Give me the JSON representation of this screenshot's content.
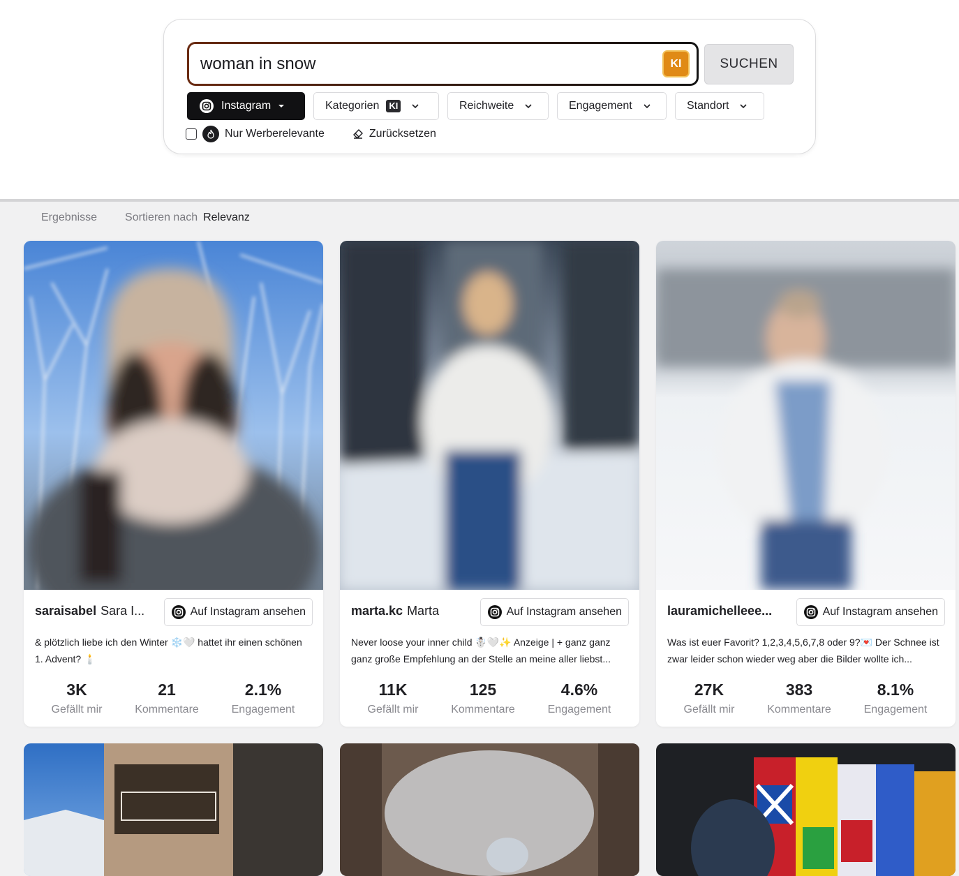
{
  "search": {
    "query": "woman in snow",
    "ki_label": "KI",
    "submit_label": "SUCHEN"
  },
  "filters": [
    {
      "label": "Instagram",
      "active": true
    },
    {
      "label": "Kategorien",
      "badge": "KI"
    },
    {
      "label": "Reichweite"
    },
    {
      "label": "Engagement"
    },
    {
      "label": "Standort"
    }
  ],
  "options": {
    "only_relevant": "Nur Werberelevante",
    "reset": "Zurücksetzen"
  },
  "results": {
    "label": "Ergebnisse",
    "sort_label": "Sortieren nach",
    "sort_value": "Relevanz"
  },
  "view_on_instagram": "Auf Instagram ansehen",
  "cards": [
    {
      "username": "saraisabel",
      "realname": "Sara I...",
      "caption": "& plötzlich liebe ich den Winter ❄️🤍 hattet ihr einen schönen 1. Advent? 🕯️",
      "likes": "3K",
      "comments": "21",
      "engagement": "2.1%"
    },
    {
      "username": "marta.kc",
      "realname": "Marta",
      "caption": "Never loose your inner child ☃️🤍✨ Anzeige | + ganz ganz ganz große Empfehlung an der Stelle an meine aller liebst...",
      "likes": "11K",
      "comments": "125",
      "engagement": "4.6%"
    },
    {
      "username": "lauramichelleee...",
      "realname": "",
      "caption": "Was ist euer Favorit? 1,2,3,4,5,6,7,8 oder 9?💌 Der Schnee ist zwar leider schon wieder weg aber die Bilder wollte ich...",
      "likes": "27K",
      "comments": "383",
      "engagement": "8.1%"
    }
  ],
  "stat_labels": {
    "likes": "Gefällt mir",
    "comments": "Kommentare",
    "engagement": "Engagement"
  },
  "colors": {
    "accent_orange": "#e08a16",
    "dark": "#111113",
    "page_bg": "#f1f1f2"
  },
  "icons": [
    "instagram-icon",
    "chevron-down-icon",
    "flame-icon",
    "eraser-icon",
    "ki-icon"
  ]
}
